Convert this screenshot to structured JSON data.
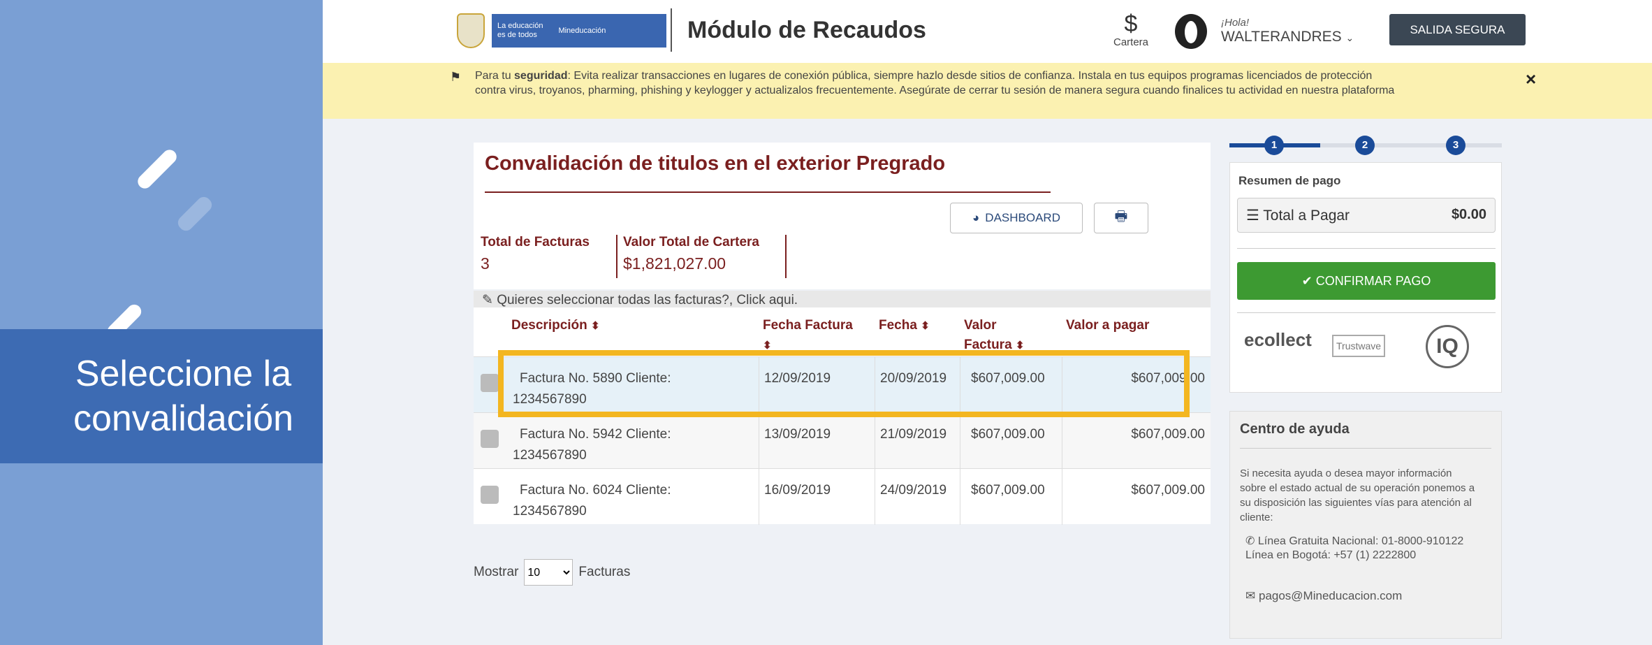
{
  "tutorial": {
    "callout_text": "Seleccione la\nconvalidación"
  },
  "header": {
    "brand_line1": "La educación",
    "brand_line2": "es de todos",
    "brand_ministry": "Mineducación",
    "module_title": "Módulo de Recaudos",
    "cartera_symbol": "$",
    "cartera_label": "Cartera",
    "greeting": "¡Hola!",
    "username": "WALTERANDRES",
    "exit_button": "SALIDA SEGURA"
  },
  "security_banner": {
    "prefix": "Para tu ",
    "bold": "seguridad",
    "text": ": Evita realizar transacciones en lugares de conexión pública, siempre hazlo desde sitios de confianza. Instala en tus equipos programas licenciados de protección contra virus, troyanos, pharming, phishing y keylogger y actualizalos frecuentemente. Asegúrate de cerrar tu sesión de manera segura cuando finalices tu actividad en nuestra plataforma",
    "close": "×"
  },
  "main": {
    "title": "Convalidación de titulos en el exterior Pregrado",
    "dashboard_button": "DASHBOARD",
    "stats": {
      "total_facturas_label": "Total de Facturas",
      "total_facturas_value": "3",
      "valor_total_label": "Valor Total de Cartera",
      "valor_total_value": "$1,821,027.00"
    },
    "select_all": "Quieres seleccionar todas las facturas?, Click aqui.",
    "columns": {
      "descripcion": "Descripción",
      "fecha_factura": "Fecha Factura",
      "fecha": "Fecha",
      "valor_factura": "Valor Factura",
      "valor_pagar": "Valor a pagar"
    },
    "rows": [
      {
        "descripcion": "Factura No. 5890 Cliente: 1234567890",
        "fecha_factura": "12/09/2019",
        "fecha": "20/09/2019",
        "valor": "$607,009.00",
        "pagar": "$607,009.00"
      },
      {
        "descripcion": "Factura No. 5942 Cliente: 1234567890",
        "fecha_factura": "13/09/2019",
        "fecha": "21/09/2019",
        "valor": "$607,009.00",
        "pagar": "$607,009.00"
      },
      {
        "descripcion": "Factura No. 6024 Cliente: 1234567890",
        "fecha_factura": "16/09/2019",
        "fecha": "24/09/2019",
        "valor": "$607,009.00",
        "pagar": "$607,009.00"
      }
    ],
    "show_label": "Mostrar",
    "show_value": "10",
    "show_suffix": "Facturas"
  },
  "steps": [
    "1",
    "2",
    "3"
  ],
  "summary": {
    "title": "Resumen de pago",
    "total_label": "Total a Pagar",
    "total_value": "$0.00",
    "confirm_button": "CONFIRMAR PAGO",
    "logos": [
      "ecollect",
      "Trustwave",
      "IQ"
    ]
  },
  "help": {
    "title": "Centro de ayuda",
    "text": "Si necesita ayuda o desea mayor información sobre el estado actual de su operación ponemos a su disposición las siguientes vías para atención al cliente:",
    "phone": "Línea Gratuita Nacional: 01-8000-910122 Línea en Bogotá: +57 (1) 2222800",
    "email": "pagos@Mineducacion.com"
  },
  "colors": {
    "accent_dark_red": "#7a1f1f",
    "tutorial_blue": "#3d6bb3",
    "highlight_yellow": "#f3b620",
    "confirm_green": "#3d9a32",
    "step_blue": "#1a4b99"
  }
}
